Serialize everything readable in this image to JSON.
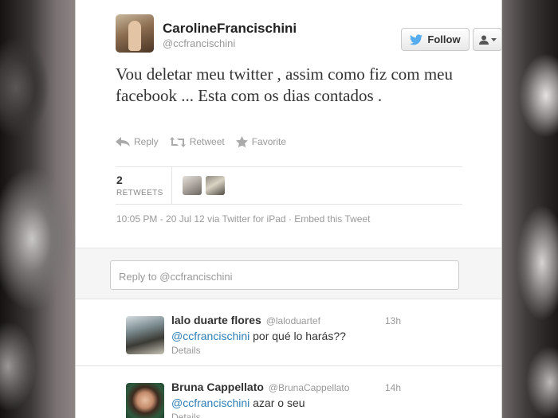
{
  "author": {
    "name": "CarolineFrancischini",
    "handle": "@ccfrancischini"
  },
  "buttons": {
    "follow_label": "Follow",
    "user_menu_icon": "user-dropdown-icon"
  },
  "tweet": {
    "text": "Vou deletar meu twitter , assim como fiz com meu facebook ... Esta com os dias contados ."
  },
  "actions": [
    {
      "label": "Reply",
      "icon": "reply-icon"
    },
    {
      "label": "Retweet",
      "icon": "retweet-icon"
    },
    {
      "label": "Favorite",
      "icon": "star-icon"
    }
  ],
  "stats": {
    "retweet_count": "2",
    "retweet_label": "RETWEETS"
  },
  "meta": {
    "timestamp": "10:05 PM - 20 Jul 12",
    "via": "via Twitter for iPad",
    "separator": "·",
    "embed": "Embed this Tweet"
  },
  "reply_box": {
    "placeholder": "Reply to @ccfrancischini"
  },
  "replies": [
    {
      "name": "lalo duarte flores",
      "handle": "@laloduartef",
      "time": "13h",
      "mention": "@ccfrancischini",
      "text": " por qué lo harás??",
      "details": "Details"
    },
    {
      "name": "Bruna Cappellato",
      "handle": "@BrunaCappellato",
      "time": "14h",
      "mention": "@ccfrancischini",
      "text": " azar o seu",
      "details": "Details"
    }
  ],
  "colors": {
    "link": "#2f7fb6",
    "twitter_bird": "#55acee"
  }
}
